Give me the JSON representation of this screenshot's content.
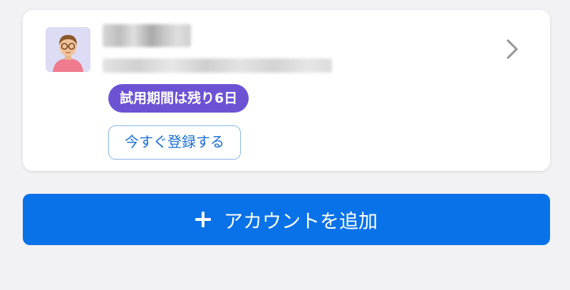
{
  "account": {
    "trial_badge": "試用期間は残り6日",
    "register_label": "今すぐ登録する"
  },
  "actions": {
    "add_account_label": "アカウントを追加"
  },
  "icons": {
    "avatar": "person-avatar-icon",
    "chevron": "chevron-right-icon",
    "plus": "plus-icon"
  },
  "colors": {
    "trial_badge": "#6d53d4",
    "primary_button": "#0a72e8",
    "register_text": "#1a6fd6",
    "background": "#f2f2f4"
  }
}
